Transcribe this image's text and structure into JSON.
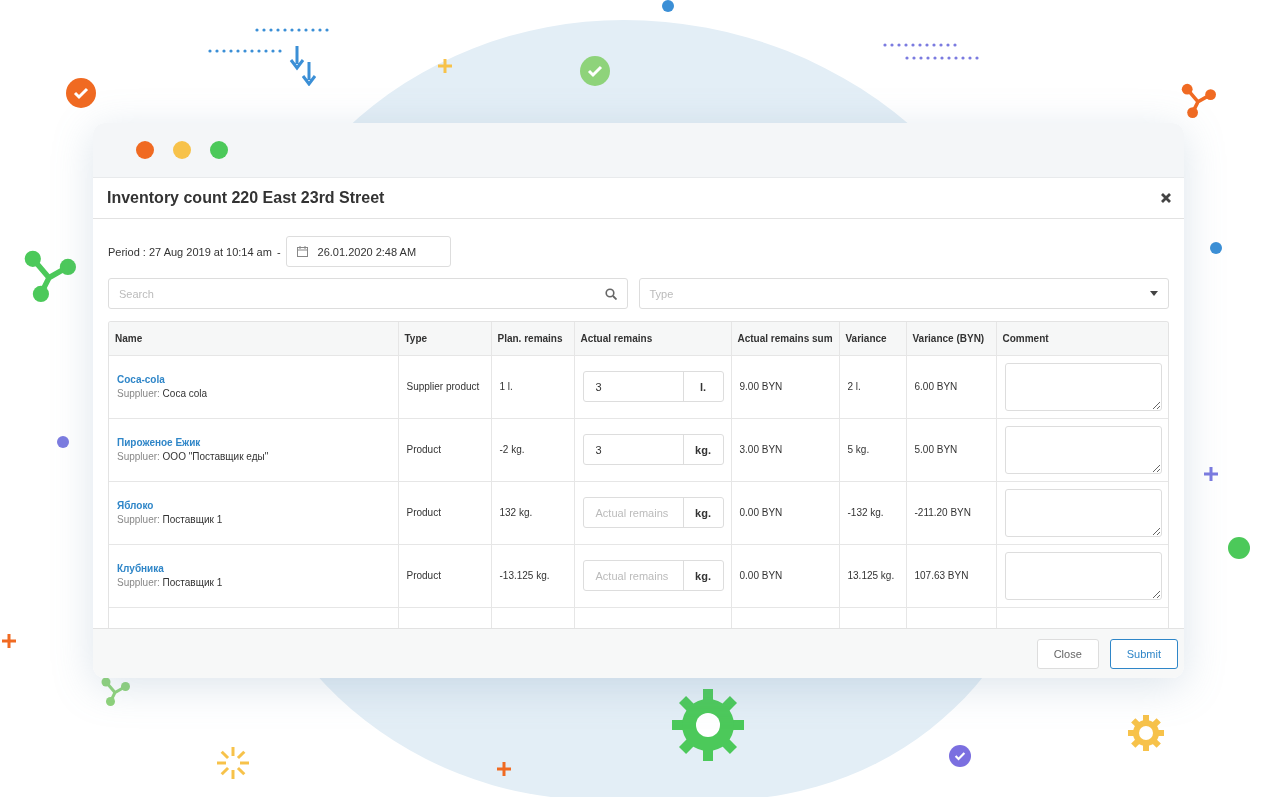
{
  "window": {
    "title": "Inventory count 220 East 23rd Street"
  },
  "period": {
    "label": "Period : 27 Aug 2019 at 10:14 am",
    "separator": "-",
    "end_date": "26.01.2020 2:48 AM"
  },
  "filters": {
    "search_placeholder": "Search",
    "type_placeholder": "Type"
  },
  "table": {
    "columns": [
      "Name",
      "Type",
      "Plan. remains",
      "Actual remains",
      "Actual remains sum",
      "Variance",
      "Variance (BYN)",
      "Comment"
    ],
    "rows": [
      {
        "name": "Coca-cola",
        "supplier_label": "Suppluer:",
        "supplier": "Coca cola",
        "type": "Supplier product",
        "plan_remains": "1 l.",
        "actual": {
          "value": "3"
        },
        "unit": "l.",
        "sum": "9.00 BYN",
        "variance": "2 l.",
        "variance_byn": "6.00 BYN"
      },
      {
        "name": "Пироженое Ежик",
        "supplier_label": "Suppluer:",
        "supplier": "ООО \"Поставщик еды\"",
        "type": "Product",
        "plan_remains": "-2 kg.",
        "actual": {
          "value": "3"
        },
        "unit": "kg.",
        "sum": "3.00 BYN",
        "variance": "5 kg.",
        "variance_byn": "5.00 BYN"
      },
      {
        "name": "Яблоко",
        "supplier_label": "Suppluer:",
        "supplier": "Поставщик 1",
        "type": "Product",
        "plan_remains": "132 kg.",
        "actual": {
          "placeholder": "Actual remains"
        },
        "unit": "kg.",
        "sum": "0.00 BYN",
        "variance": "-132 kg.",
        "variance_byn": "-211.20 BYN"
      },
      {
        "name": "Клубника",
        "supplier_label": "Suppluer:",
        "supplier": "Поставщик 1",
        "type": "Product",
        "plan_remains": "-13.125 kg.",
        "actual": {
          "placeholder": "Actual remains"
        },
        "unit": "kg.",
        "sum": "0.00 BYN",
        "variance": "13.125 kg.",
        "variance_byn": "107.63 BYN"
      }
    ]
  },
  "buttons": [
    {
      "label": "Close",
      "kind": "secondary"
    },
    {
      "label": "Submit",
      "kind": "primary"
    }
  ]
}
